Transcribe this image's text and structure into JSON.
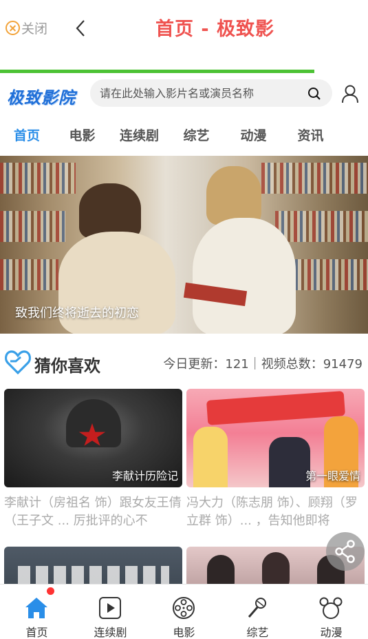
{
  "topbar": {
    "close_label": "关闭",
    "title": "首页 - 极致影"
  },
  "page_load_progress": 0.855,
  "header": {
    "logo": "极致影院",
    "search_placeholder": "请在此处输入影片名或演员名称"
  },
  "tabs": [
    {
      "label": "首页",
      "active": true
    },
    {
      "label": "电影",
      "active": false
    },
    {
      "label": "连续剧",
      "active": false
    },
    {
      "label": "综艺",
      "active": false
    },
    {
      "label": "动漫",
      "active": false
    },
    {
      "label": "资讯",
      "active": false
    }
  ],
  "banner": {
    "caption": "致我们终将逝去的初恋"
  },
  "section": {
    "title": "猜你喜欢",
    "stats": "今日更新：121｜视频总数：91479"
  },
  "cards": [
    {
      "title": "李献计历险记",
      "desc": "李献计（房祖名 饰）跟女友王倩（王子文 ... 厉批评的心不"
    },
    {
      "title": "第一眼爱情",
      "desc": "冯大力（陈志朋 饰）、顾翔（罗立群 饰）... ，告知他即将"
    },
    {
      "title": "",
      "desc": ""
    },
    {
      "title": "",
      "desc": ""
    }
  ],
  "bottom_nav": [
    {
      "label": "首页",
      "icon": "home-icon",
      "active": true,
      "badge": true
    },
    {
      "label": "连续剧",
      "icon": "play-icon",
      "active": false
    },
    {
      "label": "电影",
      "icon": "film-reel-icon",
      "active": false
    },
    {
      "label": "综艺",
      "icon": "microphone-icon",
      "active": false
    },
    {
      "label": "动漫",
      "icon": "mickey-icon",
      "active": false
    }
  ],
  "colors": {
    "title_red": "#ef5350",
    "tab_active": "#2a8ee8",
    "progress_green": "#4cc234",
    "logo_blue": "#1f6fd8"
  }
}
